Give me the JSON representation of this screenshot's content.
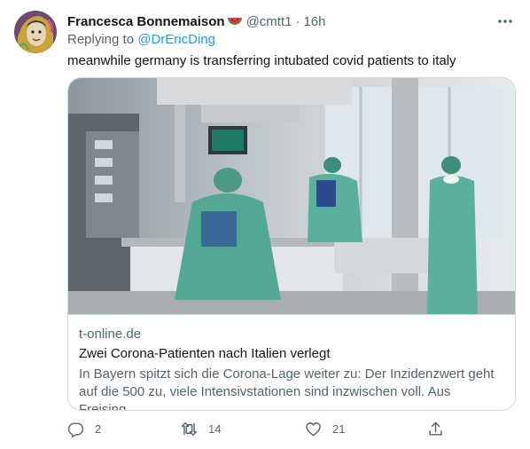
{
  "tweet": {
    "display_name": "Francesca Bonnemaison",
    "name_emoji": "watermelon-icon",
    "handle": "@cmtt1",
    "separator": "·",
    "time": "16h",
    "reply_prefix": "Replying to ",
    "reply_to": "@DrEricDing",
    "text": "meanwhile germany is transferring intubated covid patients to italy"
  },
  "card": {
    "image": "icu-photo",
    "domain": "t-online.de",
    "title": "Zwei Corona-Patienten nach Italien verlegt",
    "description": "In Bayern spitzt sich die Corona-Lage weiter zu: Der Inzidenzwert geht auf die 500 zu, viele Intensivstationen sind inzwischen voll. Aus Freising..."
  },
  "actions": {
    "reply_count": "2",
    "retweet_count": "14",
    "like_count": "21"
  },
  "colors": {
    "text": "#0f1419",
    "secondary": "#536471",
    "link": "#1d9bf0",
    "border": "#cfd9de",
    "watermelon_red": "#e8384f",
    "watermelon_green": "#3e9a3c"
  }
}
